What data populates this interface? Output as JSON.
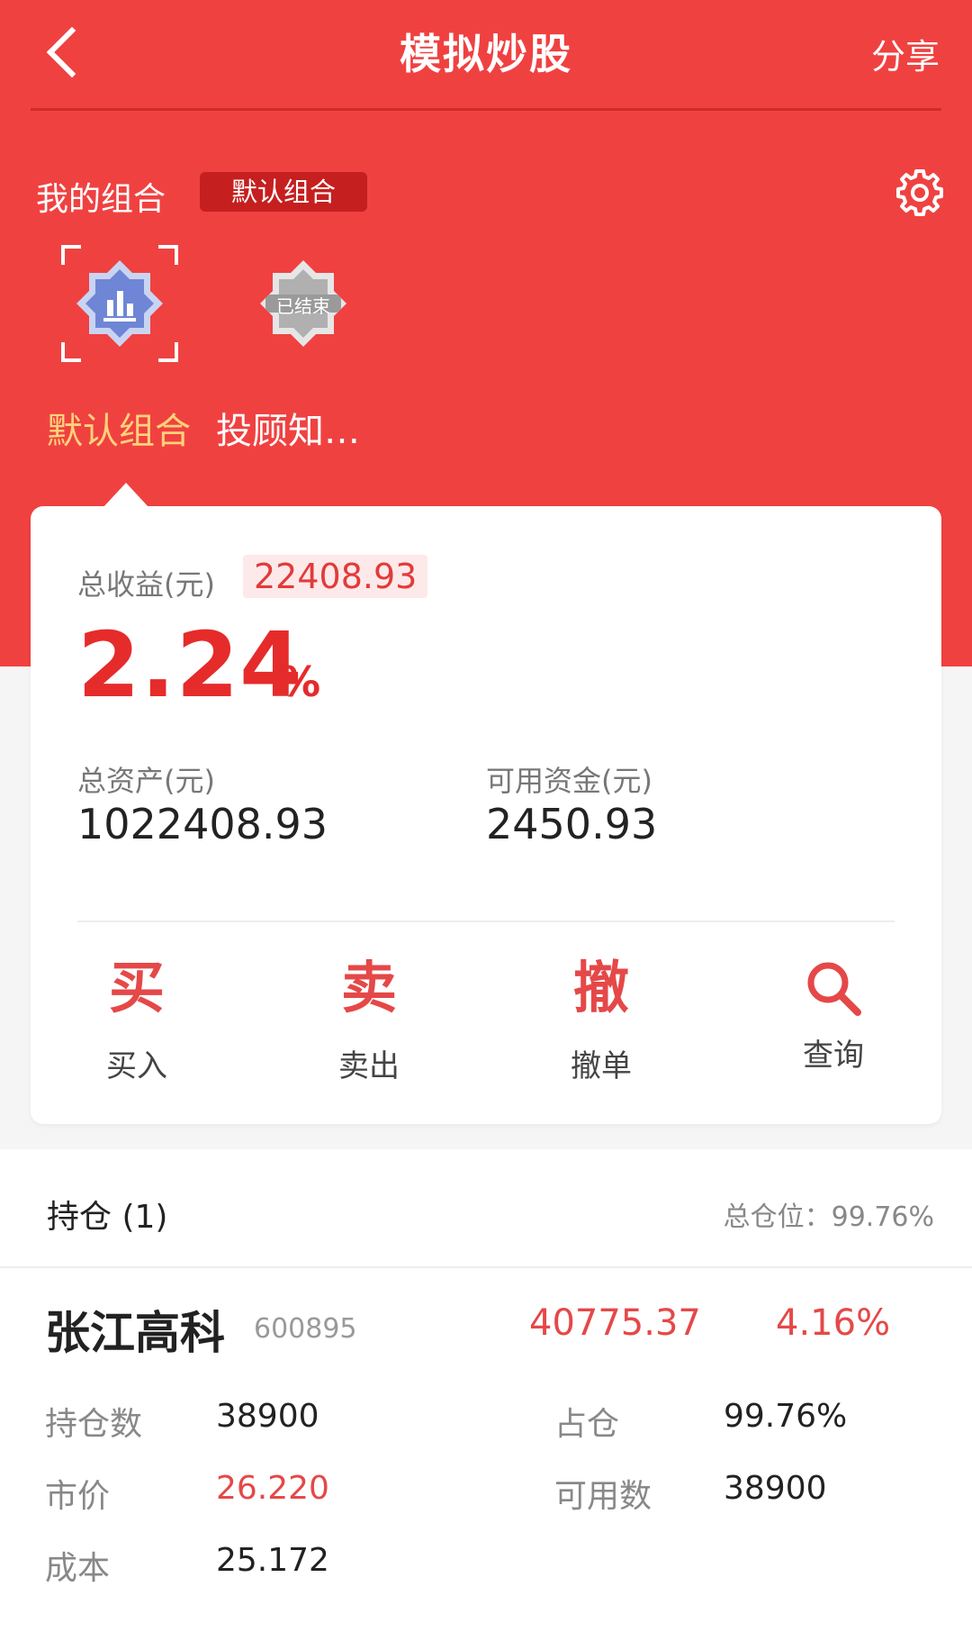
{
  "header": {
    "title": "模拟炒股",
    "share_label": "分享"
  },
  "group": {
    "label": "我的组合",
    "badge": "默认组合",
    "portfolios": [
      {
        "label": "默认组合",
        "selected": true
      },
      {
        "label": "投顾知…",
        "badge": "已结束"
      }
    ]
  },
  "summary": {
    "profit_label": "总收益(元)",
    "profit_value": "22408.93",
    "profit_pct": "2.24",
    "pct_sign": "%",
    "assets_label": "总资产(元)",
    "assets_value": "1022408.93",
    "available_label": "可用资金(元)",
    "available_value": "2450.93"
  },
  "actions": [
    {
      "glyph": "买",
      "label": "买入"
    },
    {
      "glyph": "卖",
      "label": "卖出"
    },
    {
      "glyph": "撤",
      "label": "撤单"
    },
    {
      "icon": "search-icon",
      "label": "查询"
    }
  ],
  "holdings": {
    "title": "持仓 (1)",
    "position_ratio": "总仓位：99.76%",
    "stock": {
      "name": "张江高科",
      "code": "600895",
      "market_value": "40775.37",
      "profit_pct": "4.16%",
      "qty_label": "持仓数",
      "qty": "38900",
      "share_label": "占仓",
      "share": "99.76%",
      "price_label": "市价",
      "price": "26.220",
      "avail_label": "可用数",
      "avail": "38900",
      "cost_label": "成本",
      "cost": "25.172"
    }
  },
  "colors": {
    "brand_red": "#f04141",
    "accent_red": "#e54848",
    "gold": "#ffd27a"
  }
}
